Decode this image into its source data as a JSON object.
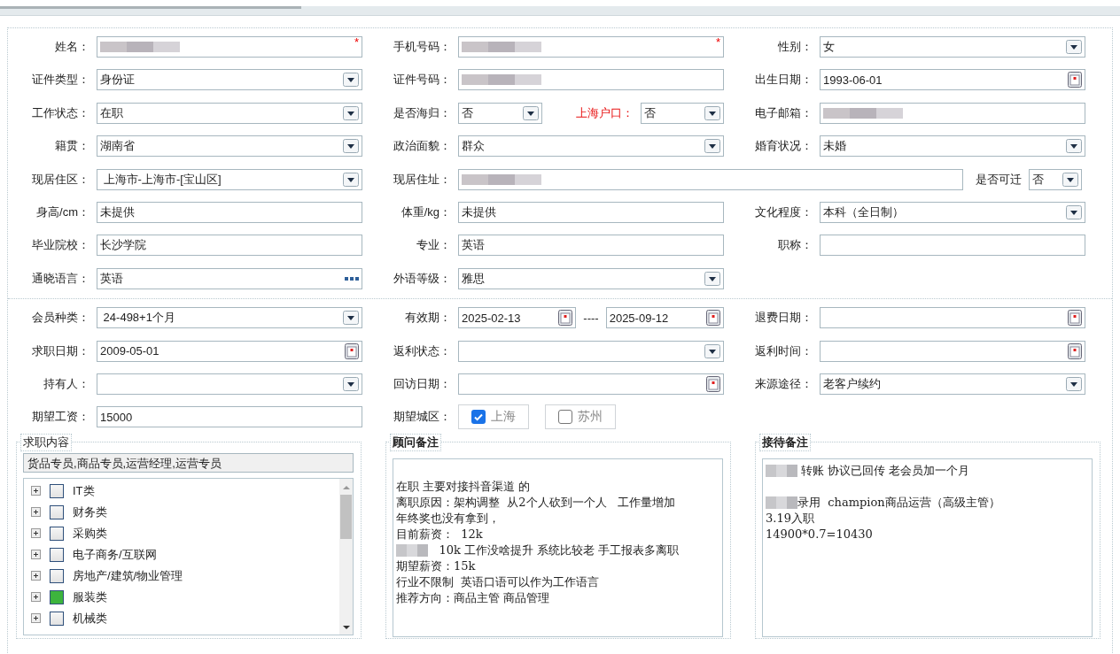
{
  "section_1": {
    "rows": [
      [
        {
          "label": "姓名：",
          "fields": [
            {
              "kind": "text",
              "redacted": true,
              "required_mark": "*"
            }
          ]
        },
        {
          "label": "手机号码：",
          "fields": [
            {
              "kind": "text",
              "redacted": true,
              "required_mark": "*"
            }
          ]
        },
        {
          "label": "性别：",
          "fields": [
            {
              "kind": "select",
              "value": "女"
            }
          ]
        }
      ],
      [
        {
          "label": "证件类型：",
          "fields": [
            {
              "kind": "select",
              "value": "身份证"
            }
          ]
        },
        {
          "label": "证件号码：",
          "fields": [
            {
              "kind": "text",
              "redacted": true
            }
          ]
        },
        {
          "label": "出生日期：",
          "fields": [
            {
              "kind": "date",
              "value": "1993-06-01"
            }
          ]
        }
      ],
      [
        {
          "label": "工作状态：",
          "fields": [
            {
              "kind": "select",
              "value": "在职"
            }
          ]
        },
        {
          "label": "是否海归：",
          "fields": [
            {
              "kind": "select",
              "value": "否"
            },
            {
              "kind": "label",
              "text": "上海户口：",
              "highlight": true
            },
            {
              "kind": "select",
              "value": "否"
            }
          ]
        },
        {
          "label": "电子邮箱：",
          "fields": [
            {
              "kind": "text",
              "redacted": true
            }
          ]
        }
      ],
      [
        {
          "label": "籍贯：",
          "fields": [
            {
              "kind": "select",
              "value": "湖南省"
            }
          ]
        },
        {
          "label": "政治面貌：",
          "fields": [
            {
              "kind": "select",
              "value": "群众"
            }
          ]
        },
        {
          "label": "婚育状况：",
          "fields": [
            {
              "kind": "select",
              "value": "未婚"
            }
          ]
        }
      ],
      [
        {
          "label": "现居住区：",
          "fields": [
            {
              "kind": "select",
              "value": " 上海市-上海市-[宝山区]"
            }
          ]
        },
        {
          "label": "现居住址：",
          "kind": "wide",
          "fields": [
            {
              "kind": "text",
              "redacted": true
            }
          ]
        },
        {
          "label": "是否可迁",
          "kind": "compact",
          "fields": [
            {
              "kind": "select",
              "value": "否"
            }
          ]
        }
      ],
      [
        {
          "label": "身高/cm：",
          "fields": [
            {
              "kind": "text",
              "value": "未提供"
            }
          ]
        },
        {
          "label": "体重/kg：",
          "fields": [
            {
              "kind": "text",
              "value": "未提供"
            }
          ]
        },
        {
          "label": "文化程度：",
          "fields": [
            {
              "kind": "select",
              "value": "本科（全日制）"
            }
          ]
        }
      ],
      [
        {
          "label": "毕业院校：",
          "fields": [
            {
              "kind": "text",
              "value": "长沙学院"
            }
          ]
        },
        {
          "label": "专业：",
          "fields": [
            {
              "kind": "text",
              "value": "英语"
            }
          ]
        },
        {
          "label": "职称：",
          "fields": [
            {
              "kind": "text"
            }
          ]
        }
      ],
      [
        {
          "label": "通晓语言：",
          "fields": [
            {
              "kind": "picker",
              "value": "英语"
            }
          ]
        },
        {
          "label": "外语等级：",
          "fields": [
            {
              "kind": "select",
              "value": "雅思"
            }
          ]
        }
      ]
    ]
  },
  "section_2": {
    "rows": [
      [
        {
          "label": "会员种类：",
          "fields": [
            {
              "kind": "select",
              "value": " 24-498+1个月"
            }
          ]
        },
        {
          "label": "有效期：",
          "fields": [
            {
              "kind": "date",
              "value": "2025-02-13"
            },
            {
              "kind": "label",
              "text": "----",
              "highlight": false
            },
            {
              "kind": "date",
              "value": "2025-09-12"
            }
          ]
        },
        {
          "label": "退费日期：",
          "fields": [
            {
              "kind": "date"
            }
          ]
        }
      ],
      [
        {
          "label": "求职日期：",
          "fields": [
            {
              "kind": "date",
              "value": "2009-05-01"
            }
          ]
        },
        {
          "label": "返利状态：",
          "fields": [
            {
              "kind": "select"
            }
          ]
        },
        {
          "label": "返利时间：",
          "fields": [
            {
              "kind": "date"
            }
          ]
        }
      ],
      [
        {
          "label": "持有人：",
          "fields": [
            {
              "kind": "select"
            }
          ]
        },
        {
          "label": "回访日期：",
          "fields": [
            {
              "kind": "date"
            }
          ]
        },
        {
          "label": "来源途径：",
          "fields": [
            {
              "kind": "select",
              "value": "老客户续约"
            }
          ]
        }
      ],
      [
        {
          "label": "期望工资：",
          "fields": [
            {
              "kind": "text",
              "value": "15000"
            }
          ]
        },
        {
          "label": "期望城区：",
          "fields": [
            {
              "kind": "checkbox",
              "text": "上海",
              "checked": true
            },
            {
              "kind": "checkbox",
              "text": "苏州",
              "checked": false
            }
          ]
        }
      ]
    ]
  },
  "job_panel": {
    "legend": "求职内容",
    "summary": "货品专员,商品专员,运营经理,运营专员",
    "tree": [
      {
        "label": "IT类",
        "checked": false,
        "expanded": false
      },
      {
        "label": "财务类",
        "checked": false,
        "expanded": false
      },
      {
        "label": "采购类",
        "checked": false,
        "expanded": false
      },
      {
        "label": "电子商务/互联网",
        "checked": false,
        "expanded": false
      },
      {
        "label": "房地产/建筑/物业管理",
        "checked": false,
        "expanded": false
      },
      {
        "label": "服装类",
        "checked": true,
        "expanded": false
      },
      {
        "label": "机械类",
        "checked": false,
        "expanded": false
      }
    ]
  },
  "notes": [
    {
      "legend": "顾问备注",
      "lines": [
        {
          "text": "在职 主要对接抖音渠道 的"
        },
        {
          "text": "离职原因：架构调整  从2个人砍到一个人   工作量增加"
        },
        {
          "text": "年终奖也没有拿到，"
        },
        {
          "text": "目前薪资：  12k"
        },
        {
          "text": "   10k 工作没啥提升 系统比较老 手工报表多离职",
          "redacted": true
        },
        {
          "text": "期望薪资：15k"
        },
        {
          "text": "行业不限制  英语口语可以作为工作语言"
        },
        {
          "text": "推荐方向：商品主管 商品管理"
        }
      ]
    },
    {
      "legend": "接待备注",
      "lines": [
        {
          "text": " 转账 协议已回传 老会员加一个月",
          "redacted": true
        },
        {
          "text": "录用  champion商品运营（高级主管）",
          "redacted": true
        },
        {
          "text": "3.19入职"
        },
        {
          "text": "14900*0.7=10430"
        }
      ]
    }
  ]
}
